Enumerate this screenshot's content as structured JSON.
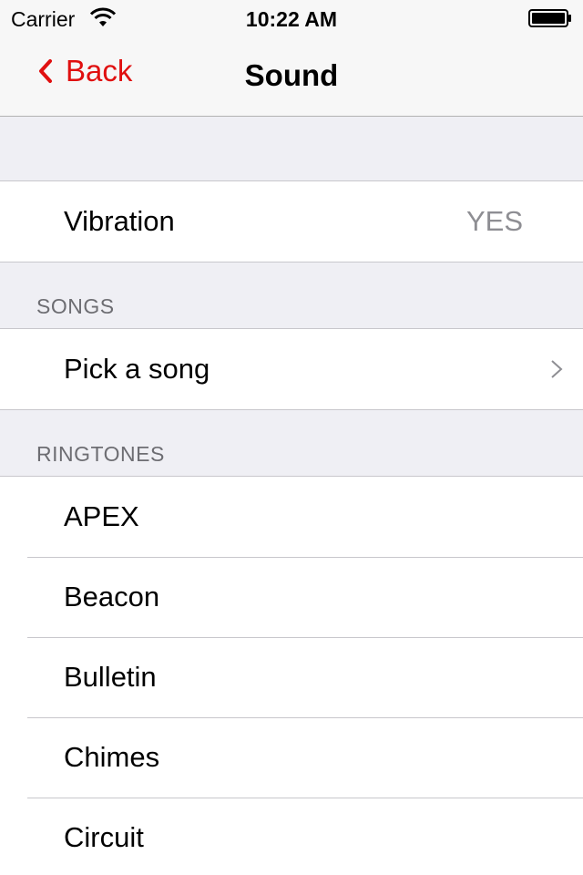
{
  "status_bar": {
    "carrier": "Carrier",
    "time": "10:22 AM"
  },
  "nav": {
    "back_label": "Back",
    "title": "Sound",
    "accent_color": "#e01010"
  },
  "vibration": {
    "label": "Vibration",
    "value": "YES"
  },
  "songs": {
    "header": "SONGS",
    "pick_label": "Pick a song"
  },
  "ringtones": {
    "header": "RINGTONES",
    "items": [
      "APEX",
      "Beacon",
      "Bulletin",
      "Chimes",
      "Circuit"
    ]
  }
}
